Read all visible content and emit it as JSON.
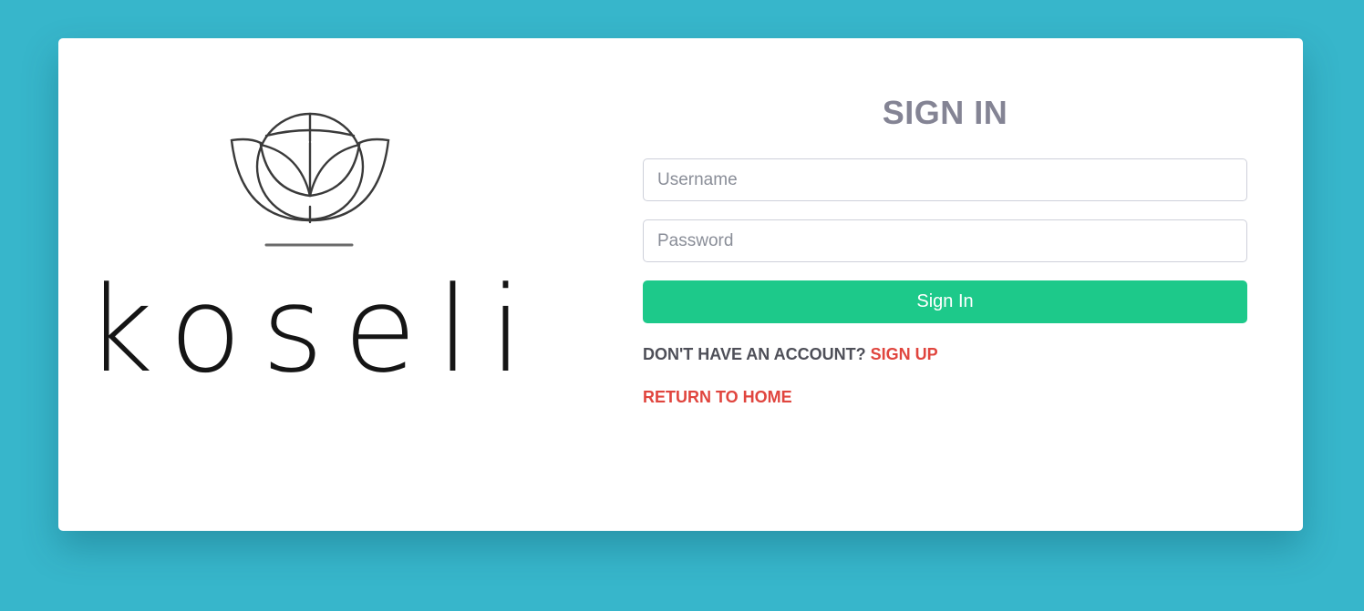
{
  "brand": {
    "name": "koseli"
  },
  "signin": {
    "title": "SIGN IN",
    "username_placeholder": "Username",
    "password_placeholder": "Password",
    "submit_label": "Sign In",
    "no_account_text": "DON'T HAVE AN ACCOUNT?",
    "signup_link": "SIGN UP",
    "return_home_link": "RETURN TO HOME"
  },
  "colors": {
    "background": "#37b6cb",
    "card": "#ffffff",
    "title": "#848494",
    "primary_button": "#1dc98a",
    "link_accent": "#e0453e",
    "muted_text": "#4e4f58"
  }
}
